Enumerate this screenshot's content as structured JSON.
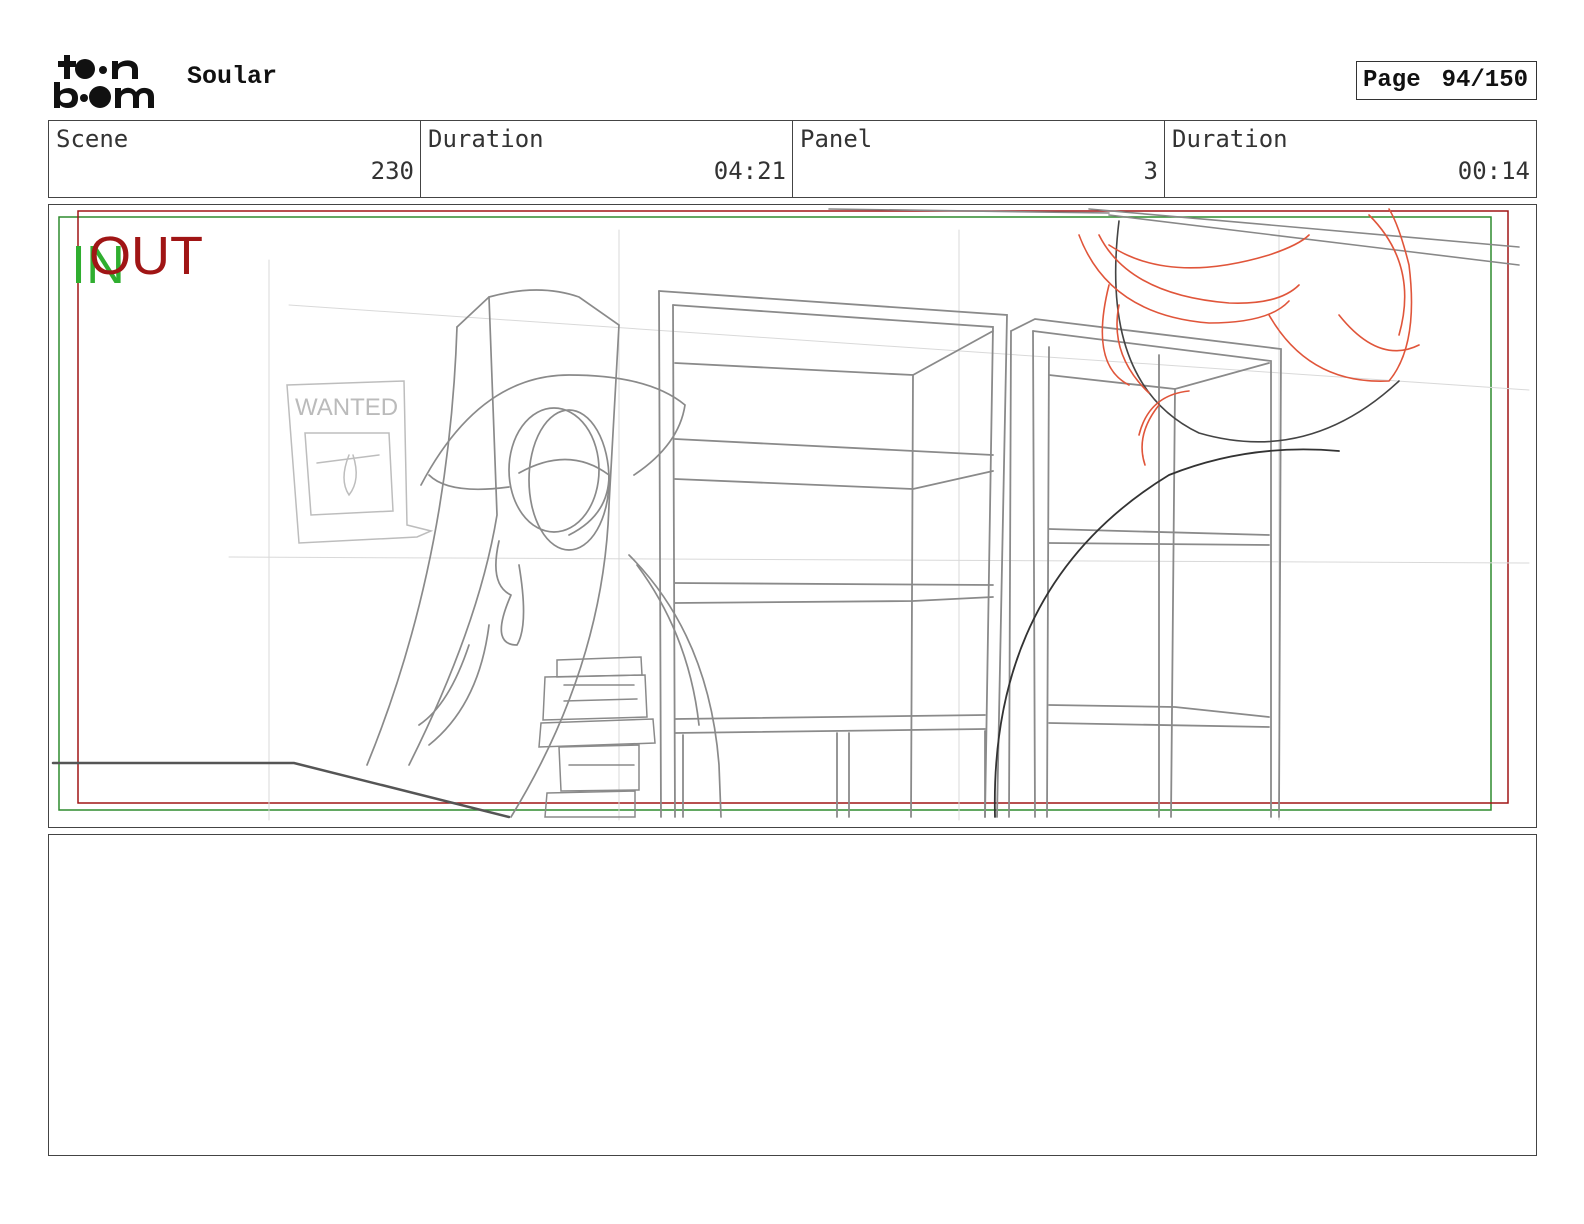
{
  "header": {
    "logo_icon": "toon-boom-logo-icon",
    "project_title": "Soular",
    "page_label": "Page",
    "page_number": "94/150"
  },
  "info": {
    "scene_label": "Scene",
    "scene_value": "230",
    "scene_duration_label": "Duration",
    "scene_duration_value": "04:21",
    "panel_label": "Panel",
    "panel_value": "3",
    "panel_duration_label": "Duration",
    "panel_duration_value": "00:14"
  },
  "panel": {
    "in_marker": "IN",
    "out_marker": "OUT",
    "poster_text": "WANTED",
    "in_color": "#2fae2f",
    "out_color": "#a01515",
    "sketch_color": "#777777",
    "accent_sketch_color": "#e0553a"
  },
  "notes": {
    "text": ""
  }
}
